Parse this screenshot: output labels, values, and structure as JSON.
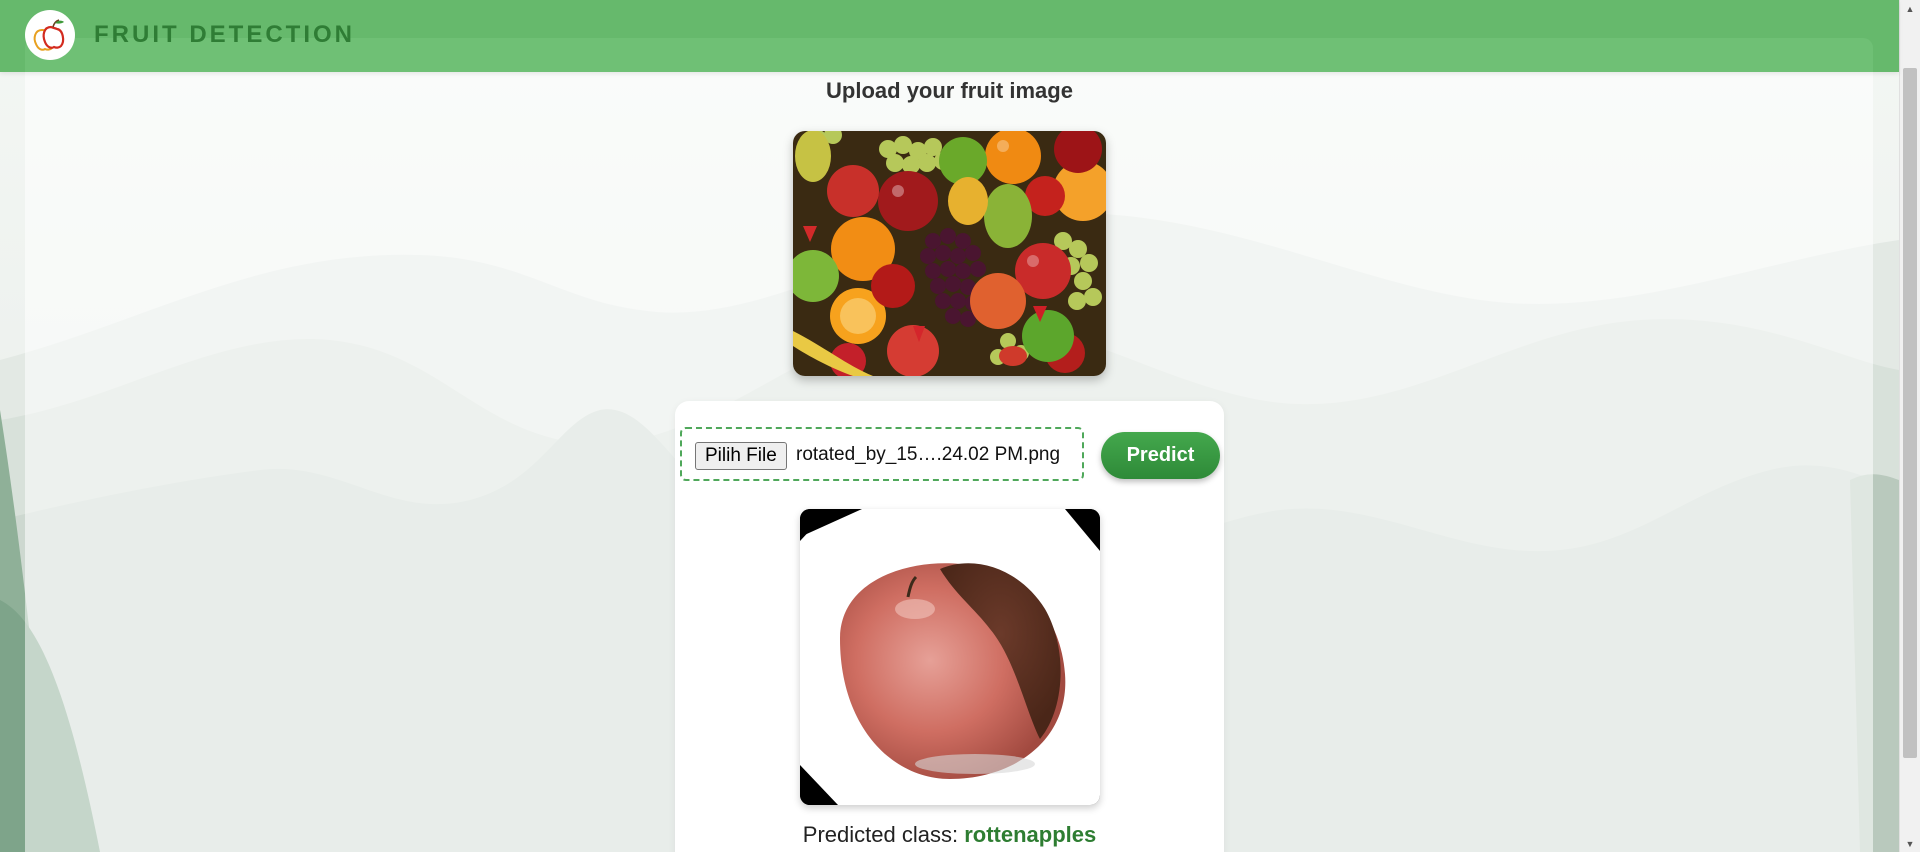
{
  "header": {
    "brand": "FRUIT DETECTION",
    "logo_icon": "apple-logo-icon"
  },
  "upload": {
    "title": "Upload your fruit image"
  },
  "file_input": {
    "button_label": "Pilih File",
    "file_name": "rotated_by_15….24.02 PM.png"
  },
  "predict_button": {
    "label": "Predict"
  },
  "result": {
    "label": "Predicted class:",
    "value": "rottenapples"
  },
  "colors": {
    "header": "#66b96c",
    "brand_text": "#2f7d35",
    "accent": "#2e8a38",
    "prediction": "#2e7d32"
  }
}
